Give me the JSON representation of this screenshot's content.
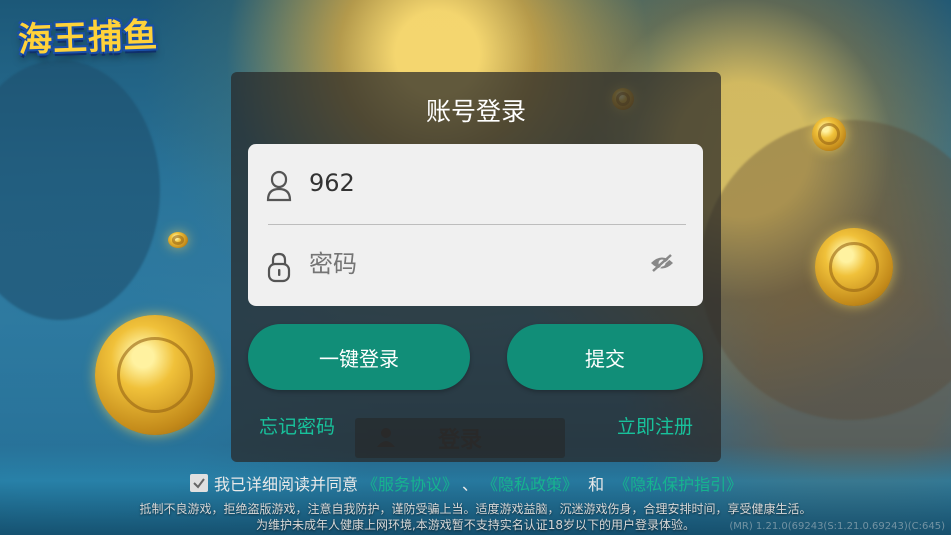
{
  "logo": {
    "text": "海王捕鱼"
  },
  "login_panel": {
    "title": "账号登录",
    "username": {
      "value": "962"
    },
    "password": {
      "placeholder": "密码"
    },
    "buttons": {
      "quick_login": "一键登录",
      "submit": "提交"
    },
    "links": {
      "forgot_password": "忘记密码",
      "register": "立即注册"
    }
  },
  "background_login_button": {
    "label": "登录"
  },
  "agreement": {
    "prefix": "我已详细阅读并同意",
    "service_terms": "《服务协议》",
    "separator": "、",
    "privacy_policy": "《隐私政策》",
    "and": "和",
    "privacy_guide": "《隐私保护指引》",
    "checked": true
  },
  "notice": {
    "line1": "抵制不良游戏，拒绝盗版游戏，注意自我防护，谨防受骗上当。适度游戏益脑，沉迷游戏伤身，合理安排时间，享受健康生活。",
    "line2": "为维护未成年人健康上网环境,本游戏暂不支持实名认证18岁以下的用户登录体验。"
  },
  "version": "(MR) 1.21.0(69243(S:1.21.0.69243)(C:645)",
  "colors": {
    "accent": "#118e78",
    "link": "#18c19b",
    "panel_bg": "rgba(40,40,40,0.72)"
  },
  "icons": [
    "user-icon",
    "lock-icon",
    "eye-off-icon",
    "checkbox-checked-icon"
  ]
}
